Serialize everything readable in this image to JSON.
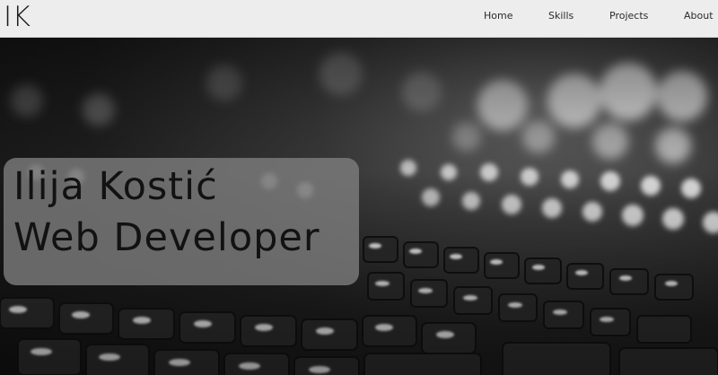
{
  "header": {
    "logo": "IK",
    "nav": [
      {
        "label": "Home"
      },
      {
        "label": "Skills"
      },
      {
        "label": "Projects"
      },
      {
        "label": "About"
      }
    ]
  },
  "hero": {
    "name": "Ilija Kostić",
    "role": "Web Developer",
    "background_image": "blurred-keyboard-photo",
    "overlay_color": "#8a8a8a"
  },
  "colors": {
    "navbar_bg": "#ededed",
    "text_dark": "#121212"
  }
}
